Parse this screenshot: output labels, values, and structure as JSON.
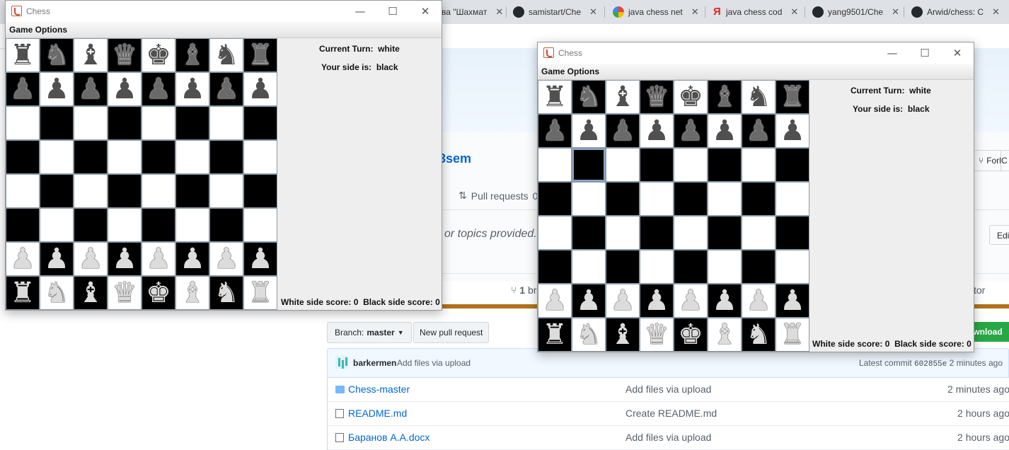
{
  "browser": {
    "tabs": [
      {
        "label": "ва \"Шахмат",
        "icon": "generic-tab-icon"
      },
      {
        "label": "samistart/Che",
        "icon": "github-icon"
      },
      {
        "label": "java chess net",
        "icon": "google-icon"
      },
      {
        "label": "java chess cod",
        "icon": "yandex-icon"
      },
      {
        "label": "yang9501/Che",
        "icon": "github-icon"
      },
      {
        "label": "Arwid/chess: C",
        "icon": "github-icon"
      }
    ],
    "tab_close_glyph": "✕"
  },
  "github": {
    "repo_name_partial": "3sem",
    "fork_label": "Fork",
    "fork_count_partial": "C",
    "pull_requests_label": "Pull requests",
    "pull_requests_count": "0",
    "description": "or topics provided.",
    "edit_label": "Edi",
    "branch_count": "1",
    "branch_label_partial": "br",
    "contributors_partial": "tor",
    "branch_button": {
      "prefix": "Branch:",
      "value": "master"
    },
    "new_pull_request": "New pull request",
    "download_label": "ownload",
    "commit": {
      "user": "barkermen",
      "message": "Add files via upload",
      "latest_prefix": "Latest commit",
      "sha": "602855e",
      "age": "2 minutes ago"
    },
    "files": [
      {
        "name": "Chess-master",
        "type": "folder",
        "message": "Add files via upload",
        "age": "2 minutes ago"
      },
      {
        "name": "README.md",
        "type": "file",
        "message": "Create README.md",
        "age": "2 hours ago"
      },
      {
        "name": "Баранов А.А.docx",
        "type": "file",
        "message": "Add files via upload",
        "age": "2 hours ago"
      }
    ]
  },
  "chess_windows": [
    {
      "title": "Chess",
      "menu": "Game Options",
      "current_turn_label": "Current Turn:",
      "current_turn_value": "white",
      "side_label": "Your side is:",
      "side_value": "black",
      "white_score_label": "White side score:",
      "white_score": "0",
      "black_score_label": "Black side score:",
      "black_score": "0",
      "selected_square": null,
      "board": [
        [
          "bR",
          "bN",
          "bB",
          "bQ",
          "bK",
          "bB",
          "bN",
          "bR"
        ],
        [
          "bP",
          "bP",
          "bP",
          "bP",
          "bP",
          "bP",
          "bP",
          "bP"
        ],
        [
          "",
          "",
          "",
          "",
          "",
          "",
          "",
          ""
        ],
        [
          "",
          "",
          "",
          "",
          "",
          "",
          "",
          ""
        ],
        [
          "",
          "",
          "",
          "",
          "",
          "",
          "",
          ""
        ],
        [
          "",
          "",
          "",
          "",
          "",
          "",
          "",
          ""
        ],
        [
          "wP",
          "wP",
          "wP",
          "wP",
          "wP",
          "wP",
          "wP",
          "wP"
        ],
        [
          "wR",
          "wN",
          "wB",
          "wQ",
          "wK",
          "wB",
          "wN",
          "wR"
        ]
      ],
      "first_square": "light"
    },
    {
      "title": "Chess",
      "menu": "Game Options",
      "current_turn_label": "Current Turn:",
      "current_turn_value": "white",
      "side_label": "Your side is:",
      "side_value": "black",
      "white_score_label": "White side score:",
      "white_score": "0",
      "black_score_label": "Black side score:",
      "black_score": "0",
      "selected_square": [
        2,
        1
      ],
      "board": [
        [
          "bR",
          "bN",
          "bB",
          "bQ",
          "bK",
          "bB",
          "bN",
          "bR"
        ],
        [
          "bP",
          "bP",
          "bP",
          "bP",
          "bP",
          "bP",
          "bP",
          "bP"
        ],
        [
          "",
          "",
          "",
          "",
          "",
          "",
          "",
          ""
        ],
        [
          "",
          "",
          "",
          "",
          "",
          "",
          "",
          ""
        ],
        [
          "",
          "",
          "",
          "",
          "",
          "",
          "",
          ""
        ],
        [
          "",
          "",
          "",
          "",
          "",
          "",
          "",
          ""
        ],
        [
          "wP",
          "wP",
          "wP",
          "wP",
          "wP",
          "wP",
          "wP",
          "wP"
        ],
        [
          "wR",
          "wN",
          "wB",
          "wQ",
          "wK",
          "wB",
          "wN",
          "wR"
        ]
      ],
      "first_square": "light"
    }
  ],
  "window_controls": {
    "minimize": "—",
    "maximize": "☐",
    "close": "✕"
  }
}
